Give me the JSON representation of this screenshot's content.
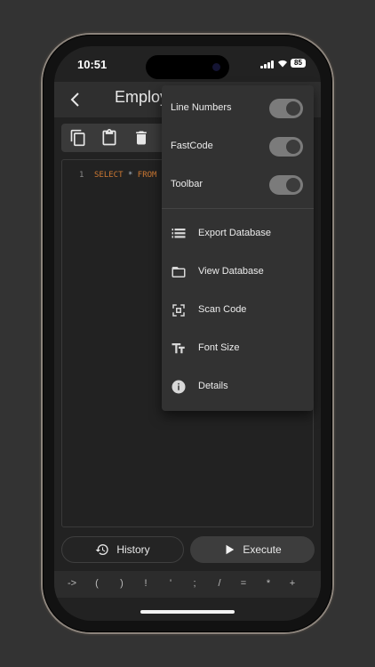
{
  "status": {
    "time": "10:51",
    "battery": "85"
  },
  "appbar": {
    "title": "Employ"
  },
  "editor": {
    "line_number": "1",
    "code_select": "SELECT",
    "code_star": "*",
    "code_from": "FROM"
  },
  "menu": {
    "toggles": [
      {
        "label": "Line Numbers",
        "on": true
      },
      {
        "label": "FastCode",
        "on": true
      },
      {
        "label": "Toolbar",
        "on": true
      }
    ],
    "actions": [
      {
        "label": "Export Database",
        "icon": "export-database-icon"
      },
      {
        "label": "View Database",
        "icon": "folder-icon"
      },
      {
        "label": "Scan Code",
        "icon": "scan-icon"
      },
      {
        "label": "Font Size",
        "icon": "font-size-icon"
      },
      {
        "label": "Details",
        "icon": "info-icon"
      }
    ]
  },
  "buttons": {
    "history": "History",
    "execute": "Execute"
  },
  "keys": [
    "->",
    "(",
    ")",
    "!",
    "'",
    ";",
    "/",
    "=",
    "*",
    "+"
  ]
}
